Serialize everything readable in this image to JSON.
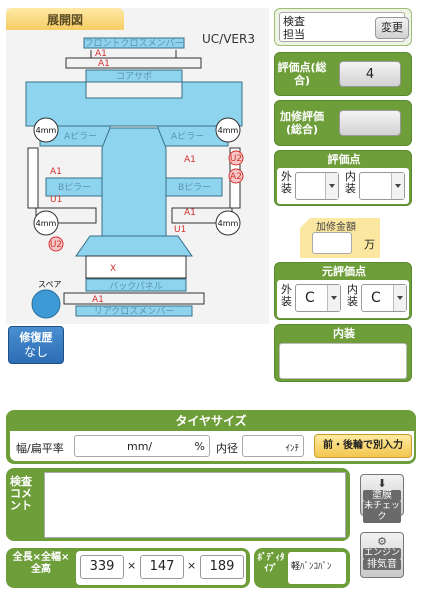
{
  "diagram": {
    "tab_label": "展開図",
    "version": "UC/VER3",
    "parts": {
      "front_cross_member": "フロントクロスメンバー",
      "core_support": "コアサポ",
      "a_pillar_left": "Aピラー",
      "a_pillar_right": "Aピラー",
      "b_pillar_left": "Bピラー",
      "b_pillar_right": "Bピラー",
      "back_panel": "バックパネル",
      "rear_cross_member": "リアクロスメンバー",
      "spare": "スペア"
    },
    "tires": [
      "4mm",
      "4mm",
      "4mm",
      "4mm"
    ],
    "marks": {
      "front_a1_top": "A1",
      "front_a1_2": "A1",
      "left_a1": "A1",
      "left_u1": "U1",
      "left_u2": "U2",
      "right_a1": "A1",
      "right_a1_2": "A1",
      "right_u1": "U1",
      "right_u2_circle": "U2",
      "right_a2_circle": "A2",
      "rear_x": "X",
      "rear_a1": "A1"
    }
  },
  "repair_history": {
    "label": "修復歴",
    "value": "なし"
  },
  "inspector": {
    "label": "検査担当",
    "change_button": "変更"
  },
  "score_total": {
    "label": "評価点(総合)",
    "value": "4"
  },
  "extra_score": {
    "label": "加修評価(総合)",
    "value": ""
  },
  "score_detail": {
    "title": "評価点",
    "exterior_label": "外装",
    "interior_label": "内装",
    "exterior_value": "",
    "interior_value": ""
  },
  "repair_amount": {
    "label": "加修金額",
    "value": "",
    "unit": "万"
  },
  "original_score": {
    "title": "元評価点",
    "exterior_label": "外装",
    "interior_label": "内装",
    "exterior_value": "C",
    "interior_value": "C"
  },
  "interior_notes": {
    "title": "内装",
    "value": ""
  },
  "tire_size": {
    "title": "タイヤサイズ",
    "width_ratio_label": "幅/扁平率",
    "mm_unit": "mm/",
    "percent_unit": "%",
    "inner_label": "内径",
    "inch_unit": "ｲﾝﾁ",
    "front_rear_button": "前・後輪で別入力"
  },
  "inspection_comment": {
    "label": "検査コメント",
    "value": ""
  },
  "side_buttons": {
    "paint": {
      "line1": "塗膜",
      "line2": "未チェック"
    },
    "engine": {
      "line1": "エンジン",
      "line2": "排気音"
    }
  },
  "dimensions": {
    "label": "全長×全幅×全高",
    "length": "339",
    "width": "147",
    "height": "189",
    "times": "×"
  },
  "body_type": {
    "label": "ﾎﾞﾃﾞｨﾀｲﾌﾟ",
    "value": "軽ﾊﾞﾝｺﾊﾞﾝ"
  },
  "colors": {
    "green": "#6e9e3a",
    "blue_part": "#8fd4ef",
    "orange_tab": "#f5cd63",
    "repair_blue": "#2c6db4"
  }
}
